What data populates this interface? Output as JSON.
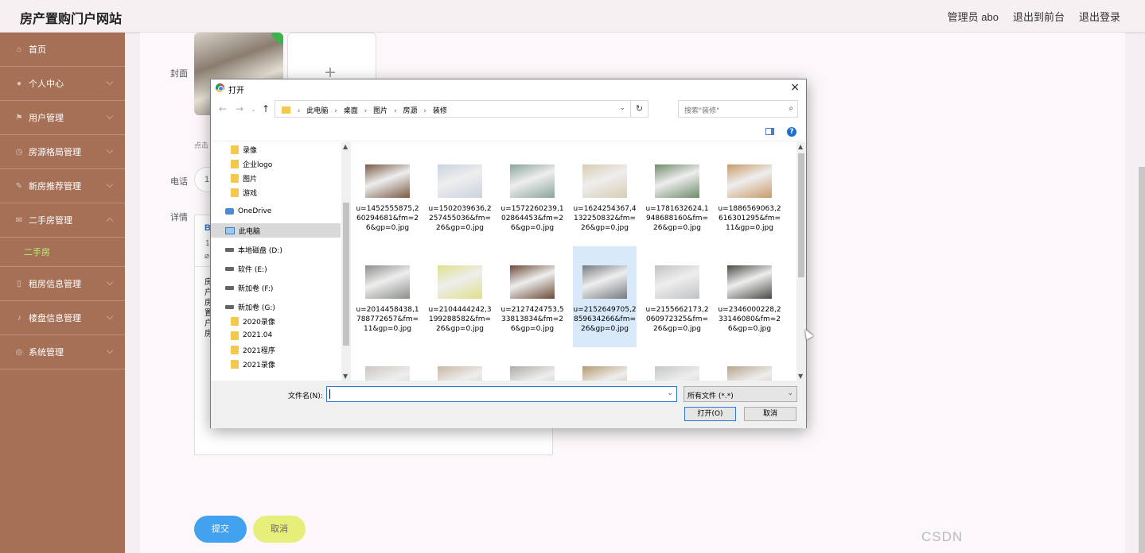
{
  "header": {
    "site_title": "房产置购门户网站",
    "user_label": "管理员 abo",
    "to_frontend": "退出到前台",
    "logout": "退出登录"
  },
  "sidebar": {
    "items": [
      {
        "label": "首页",
        "icon": "home-icon"
      },
      {
        "label": "个人中心",
        "icon": "user-icon"
      },
      {
        "label": "用户管理",
        "icon": "flag-icon"
      },
      {
        "label": "房源格局管理",
        "icon": "clock-icon"
      },
      {
        "label": "新房推荐管理",
        "icon": "edit-icon"
      },
      {
        "label": "二手房管理",
        "icon": "mail-icon",
        "expanded": true
      },
      {
        "label": "租房信息管理",
        "icon": "phone-icon"
      },
      {
        "label": "楼盘信息管理",
        "icon": "mic-icon"
      },
      {
        "label": "系统管理",
        "icon": "globe-icon"
      }
    ],
    "active_sub": "二手房"
  },
  "form": {
    "cover_label": "封面",
    "cover_hint": "点击",
    "phone_label": "电话",
    "phone_value": "1",
    "detail_label": "详情",
    "editor_toolbar_b": "B",
    "editor_toolbar_line2": "1",
    "editor_text": [
      "房",
      "户",
      "房",
      "置",
      "户",
      "房"
    ],
    "submit": "提交",
    "cancel": "取消"
  },
  "dialog": {
    "title": "打开",
    "close": "×",
    "breadcrumb": [
      "此电脑",
      "桌面",
      "图片",
      "房源",
      "装修"
    ],
    "search_placeholder": "搜索\"装修\"",
    "tree": [
      {
        "label": "录像",
        "type": "folder",
        "indent": 1
      },
      {
        "label": "企业logo",
        "type": "folder",
        "indent": 1
      },
      {
        "label": "图片",
        "type": "folder",
        "indent": 1
      },
      {
        "label": "游戏",
        "type": "folder",
        "indent": 1
      },
      {
        "label": "OneDrive",
        "type": "onedrive",
        "indent": 0
      },
      {
        "label": "此电脑",
        "type": "pc",
        "indent": 0,
        "selected": true
      },
      {
        "label": "本地磁盘 (D:)",
        "type": "drive",
        "indent": 0
      },
      {
        "label": "软件 (E:)",
        "type": "drive",
        "indent": 0
      },
      {
        "label": "新加卷 (F:)",
        "type": "drive",
        "indent": 0
      },
      {
        "label": "新加卷 (G:)",
        "type": "drive",
        "indent": 0
      },
      {
        "label": "2020录像",
        "type": "folder",
        "indent": 1
      },
      {
        "label": "2021.04",
        "type": "folder",
        "indent": 1
      },
      {
        "label": "2021程序",
        "type": "folder",
        "indent": 1
      },
      {
        "label": "2021录像",
        "type": "folder",
        "indent": 1
      }
    ],
    "files": [
      {
        "name": "u=1452555875,260294681&fm=26&gp=0.jpg",
        "color": "#7a5a44"
      },
      {
        "name": "u=1502039636,2257455036&fm=26&gp=0.jpg",
        "color": "#c9d3de"
      },
      {
        "name": "u=1572260239,102864453&fm=26&gp=0.jpg",
        "color": "#8aa59b"
      },
      {
        "name": "u=1624254367,4132250832&fm=26&gp=0.jpg",
        "color": "#d8cdb4"
      },
      {
        "name": "u=1781632624,1948688160&fm=26&gp=0.jpg",
        "color": "#6f8b6a"
      },
      {
        "name": "u=1886569063,2616301295&fm=11&gp=0.jpg",
        "color": "#c99a68"
      },
      {
        "name": "u=2014458438,1788772657&fm=11&gp=0.jpg",
        "color": "#8a8f88"
      },
      {
        "name": "u=2104444242,3199288582&fm=26&gp=0.jpg",
        "color": "#dfe08a"
      },
      {
        "name": "u=2127424753,533813834&fm=26&gp=0.jpg",
        "color": "#6b4a36"
      },
      {
        "name": "u=2152649705,2859634266&fm=26&gp=0.jpg",
        "color": "#757a80",
        "selected": true
      },
      {
        "name": "u=2155662173,2060972325&fm=26&gp=0.jpg",
        "color": "#bfc2c4"
      },
      {
        "name": "u=2346000228,233146080&fm=26&gp=0.jpg",
        "color": "#4a4a44"
      },
      {
        "name": "",
        "color": "#ccc6be"
      },
      {
        "name": "",
        "color": "#c9b8a6"
      },
      {
        "name": "",
        "color": "#b0aca6"
      },
      {
        "name": "",
        "color": "#b59a70"
      },
      {
        "name": "",
        "color": "#c4c6c8"
      },
      {
        "name": "",
        "color": "#b8a58c"
      }
    ],
    "filename_label": "文件名(N):",
    "filename_value": "",
    "filetype": "所有文件 (*.*)",
    "open_button": "打开(O)",
    "cancel_button": "取消"
  },
  "watermark": "CSDN"
}
